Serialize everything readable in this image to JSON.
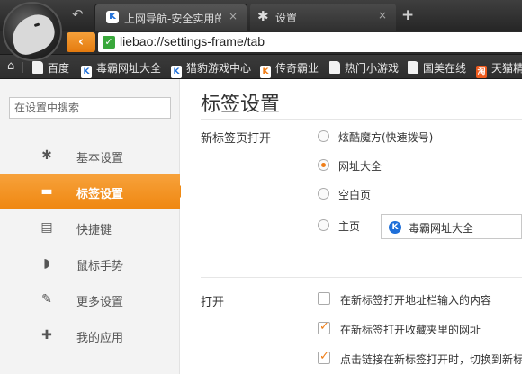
{
  "tabs": [
    {
      "title": "上网导航-安全实用的...",
      "close": "×",
      "active": false
    },
    {
      "title": "设置",
      "close": "×",
      "active": true
    }
  ],
  "new_tab_glyph": "+",
  "address": {
    "url": "liebao://settings-frame/tab",
    "back_glyph": "‹"
  },
  "bookmarks": [
    {
      "label": "百度",
      "icon": "document-icon"
    },
    {
      "label": "毒霸网址大全",
      "icon": "k-icon"
    },
    {
      "label": "猎豹游戏中心",
      "icon": "k-icon"
    },
    {
      "label": "传奇霸业",
      "icon": "k-icon"
    },
    {
      "label": "热门小游戏",
      "icon": "document-icon"
    },
    {
      "label": "国美在线",
      "icon": "document-icon"
    },
    {
      "label": "天猫精",
      "icon": "tao-icon"
    }
  ],
  "sidebar": {
    "search_placeholder": "在设置中搜索",
    "items": [
      {
        "label": "基本设置",
        "icon": "gear-icon"
      },
      {
        "label": "标签设置",
        "icon": "tab-icon"
      },
      {
        "label": "快捷键",
        "icon": "keyboard-icon"
      },
      {
        "label": "鼠标手势",
        "icon": "mouse-icon"
      },
      {
        "label": "更多设置",
        "icon": "wrench-icon"
      },
      {
        "label": "我的应用",
        "icon": "puzzle-icon"
      }
    ],
    "active_index": 1
  },
  "main": {
    "title": "标签设置",
    "newtab": {
      "label": "新标签页打开",
      "options": [
        {
          "label": "炫酷魔方(快速拨号)",
          "checked": false
        },
        {
          "label": "网址大全",
          "checked": true
        },
        {
          "label": "空白页",
          "checked": false
        },
        {
          "label": "主页",
          "checked": false
        }
      ],
      "homepage_value": "毒霸网址大全"
    },
    "open": {
      "label": "打开",
      "options": [
        {
          "label": "在新标签打开地址栏输入的内容",
          "checked": false
        },
        {
          "label": "在新标签打开收藏夹里的网址",
          "checked": true
        },
        {
          "label": "点击链接在新标签打开时，切换到新标",
          "checked": true
        }
      ]
    }
  },
  "colors": {
    "accent": "#ef8710",
    "chrome_dark": "#2c2c2c",
    "sidebar_bg": "#f3f3f3"
  }
}
